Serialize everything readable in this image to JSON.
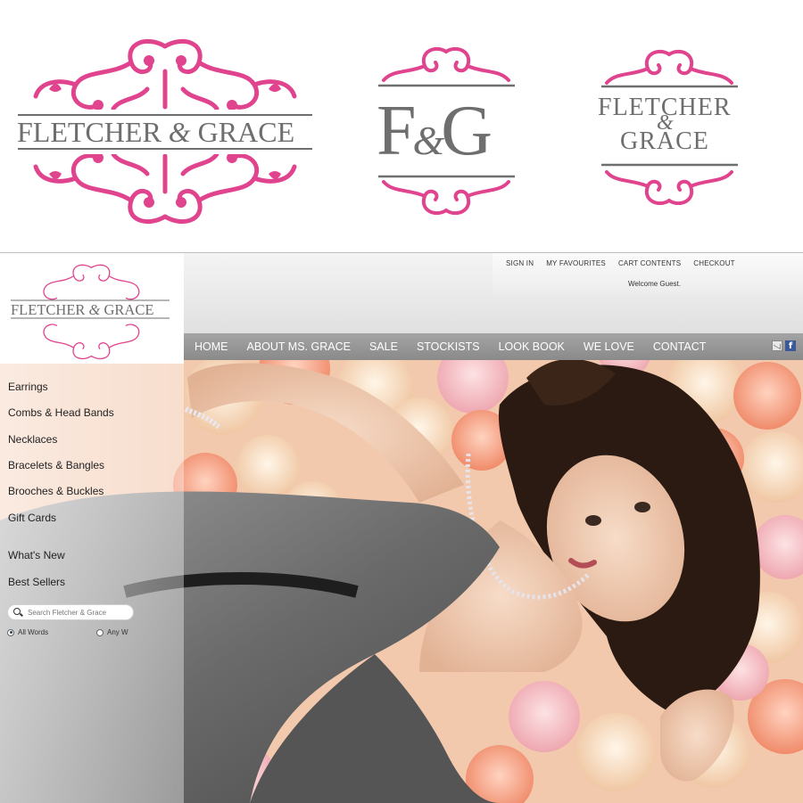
{
  "brand": {
    "colors": {
      "pink": "#e0448e",
      "grey": "#6e6e6e",
      "nav": "#949494"
    },
    "logo_primary": {
      "line1": "Fletcher",
      "amp": "&",
      "line2": "Grace"
    },
    "logo_monogram": {
      "left": "F",
      "amp": "&",
      "right": "G"
    },
    "logo_stacked": {
      "line1": "Fletcher",
      "amp": "&",
      "line2": "Grace"
    }
  },
  "header": {
    "utility_links": [
      "SIGN IN",
      "MY FAVOURITES",
      "CART CONTENTS",
      "CHECKOUT"
    ],
    "welcome": "Welcome Guest."
  },
  "nav": {
    "items": [
      "HOME",
      "ABOUT MS. GRACE",
      "SALE",
      "STOCKISTS",
      "LOOK BOOK",
      "WE LOVE",
      "CONTACT"
    ],
    "icons": [
      "mail-icon",
      "facebook-icon"
    ],
    "facebook_glyph": "f"
  },
  "sidebar": {
    "categories": [
      "Earrings",
      "Combs & Head Bands",
      "Necklaces",
      "Bracelets & Bangles",
      "Brooches & Buckles",
      "Gift Cards"
    ],
    "extras": [
      "What's New",
      "Best Sellers"
    ],
    "search_placeholder": "Search Fletcher & Grace",
    "radio_all": "All Words",
    "radio_any": "Any W"
  }
}
